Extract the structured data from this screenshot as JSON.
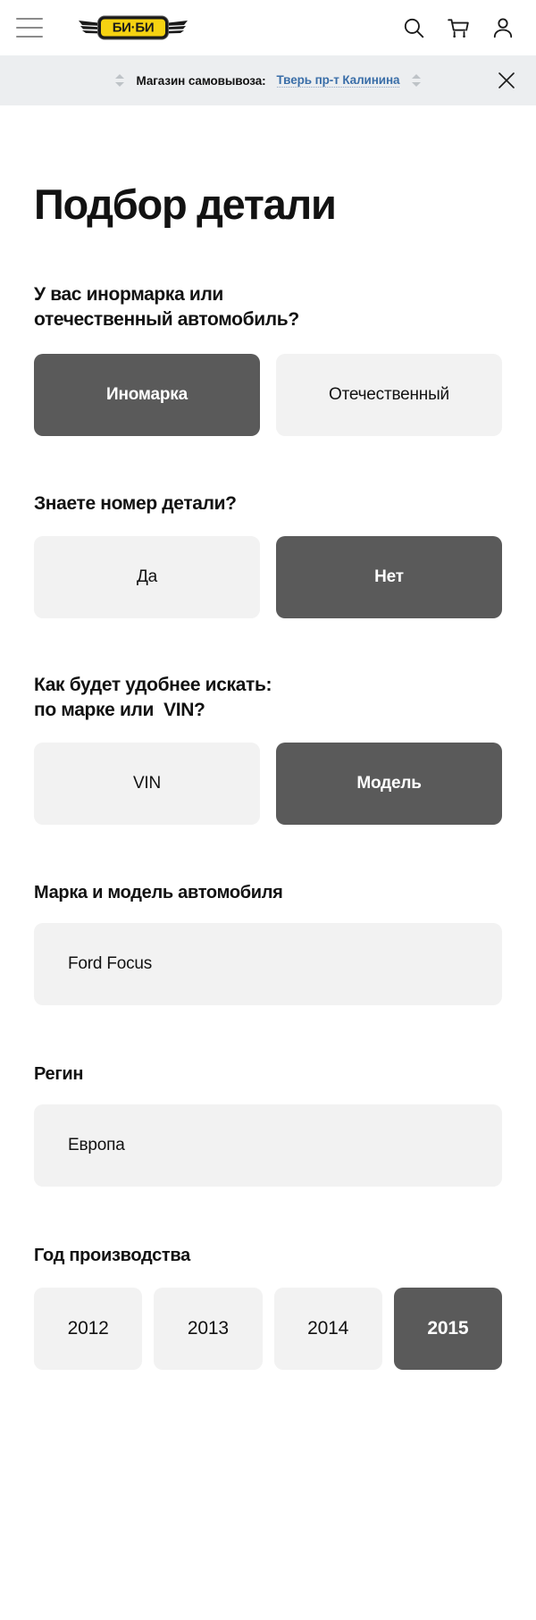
{
  "header": {
    "menu_icon": "hamburger-menu-icon",
    "logo_text": "БИ·БИ",
    "search_icon": "search-icon",
    "cart_icon": "cart-icon",
    "account_icon": "user-account-icon"
  },
  "storebar": {
    "label": "Магазин самовывоза:",
    "value": "Тверь пр-т Калинина",
    "left_spinner_icon": "spinner-updown-icon",
    "right_spinner_icon": "spinner-updown-icon",
    "close_icon": "close-icon",
    "background": "#eceef0",
    "link_color": "#3a6ea8"
  },
  "main": {
    "title": "Подбор детали",
    "questions": [
      {
        "text": "У вас инормарка или\nотечественный автомобиль?",
        "options": [
          {
            "label": "Иномарка",
            "selected": true
          },
          {
            "label": "Отечественный",
            "selected": false
          }
        ]
      },
      {
        "text": "Знаете номер детали?",
        "options": [
          {
            "label": "Да",
            "selected": false
          },
          {
            "label": "Нет",
            "selected": true
          }
        ]
      },
      {
        "text": "Как будет удобнее искать:\nпо марке или  VIN?",
        "options": [
          {
            "label": "VIN",
            "selected": false
          },
          {
            "label": "Модель",
            "selected": true
          }
        ]
      }
    ],
    "brand_field": {
      "label": "Марка и модель автомобиля",
      "value": "Ford Focus"
    },
    "region_field": {
      "label": "Регин",
      "value": "Европа"
    },
    "year_field": {
      "label": "Год производства",
      "options": [
        {
          "label": "2012",
          "selected": false
        },
        {
          "label": "2013",
          "selected": false
        },
        {
          "label": "2014",
          "selected": false
        },
        {
          "label": "2015",
          "selected": true
        }
      ]
    }
  },
  "colors": {
    "selected_bg": "#5a5a5a",
    "unselected_bg": "#f2f2f2",
    "logo_yellow": "#f5d211",
    "text": "#121212"
  }
}
